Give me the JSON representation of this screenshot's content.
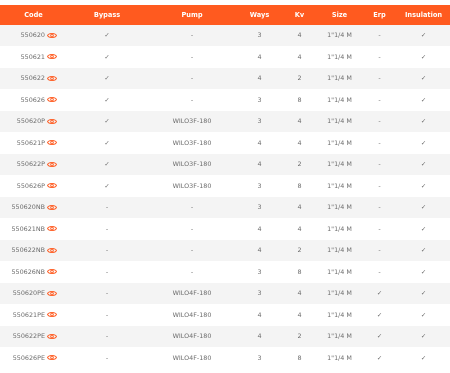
{
  "table": {
    "headers": [
      "Code",
      "Bypass",
      "Pump",
      "Ways",
      "Kv",
      "Size",
      "Erp",
      "Insulation"
    ],
    "rows": [
      {
        "code": "550620",
        "bypass": "✓",
        "pump": "-",
        "ways": "3",
        "kv": "4",
        "size": "1\"1/4 M",
        "erp": "-",
        "insulation": "✓"
      },
      {
        "code": "550621",
        "bypass": "✓",
        "pump": "-",
        "ways": "4",
        "kv": "4",
        "size": "1\"1/4 M",
        "erp": "-",
        "insulation": "✓"
      },
      {
        "code": "550622",
        "bypass": "✓",
        "pump": "-",
        "ways": "4",
        "kv": "2",
        "size": "1\"1/4 M",
        "erp": "-",
        "insulation": "✓"
      },
      {
        "code": "550626",
        "bypass": "✓",
        "pump": "-",
        "ways": "3",
        "kv": "8",
        "size": "1\"1/4 M",
        "erp": "-",
        "insulation": "✓"
      },
      {
        "code": "550620P",
        "bypass": "✓",
        "pump": "WILO3F-180",
        "ways": "3",
        "kv": "4",
        "size": "1\"1/4 M",
        "erp": "-",
        "insulation": "✓"
      },
      {
        "code": "550621P",
        "bypass": "✓",
        "pump": "WILO3F-180",
        "ways": "4",
        "kv": "4",
        "size": "1\"1/4 M",
        "erp": "-",
        "insulation": "✓"
      },
      {
        "code": "550622P",
        "bypass": "✓",
        "pump": "WILO3F-180",
        "ways": "4",
        "kv": "2",
        "size": "1\"1/4 M",
        "erp": "-",
        "insulation": "✓"
      },
      {
        "code": "550626P",
        "bypass": "✓",
        "pump": "WILO3F-180",
        "ways": "3",
        "kv": "8",
        "size": "1\"1/4 M",
        "erp": "-",
        "insulation": "✓"
      },
      {
        "code": "550620NB",
        "bypass": "-",
        "pump": "-",
        "ways": "3",
        "kv": "4",
        "size": "1\"1/4 M",
        "erp": "-",
        "insulation": "✓"
      },
      {
        "code": "550621NB",
        "bypass": "-",
        "pump": "-",
        "ways": "4",
        "kv": "4",
        "size": "1\"1/4 M",
        "erp": "-",
        "insulation": "✓"
      },
      {
        "code": "550622NB",
        "bypass": "-",
        "pump": "-",
        "ways": "4",
        "kv": "2",
        "size": "1\"1/4 M",
        "erp": "-",
        "insulation": "✓"
      },
      {
        "code": "550626NB",
        "bypass": "-",
        "pump": "-",
        "ways": "3",
        "kv": "8",
        "size": "1\"1/4 M",
        "erp": "-",
        "insulation": "✓"
      },
      {
        "code": "550620PE",
        "bypass": "-",
        "pump": "WILO4F-180",
        "ways": "3",
        "kv": "4",
        "size": "1\"1/4 M",
        "erp": "✓",
        "insulation": "✓"
      },
      {
        "code": "550621PE",
        "bypass": "-",
        "pump": "WILO4F-180",
        "ways": "4",
        "kv": "4",
        "size": "1\"1/4 M",
        "erp": "✓",
        "insulation": "✓"
      },
      {
        "code": "550622PE",
        "bypass": "-",
        "pump": "WILO4F-180",
        "ways": "4",
        "kv": "2",
        "size": "1\"1/4 M",
        "erp": "✓",
        "insulation": "✓"
      },
      {
        "code": "550626PE",
        "bypass": "-",
        "pump": "WILO4F-180",
        "ways": "3",
        "kv": "8",
        "size": "1\"1/4 M",
        "erp": "✓",
        "insulation": "✓"
      }
    ]
  },
  "icons": {
    "view": "eye-icon"
  },
  "colors": {
    "header_bg": "#ff5a1f",
    "header_text": "#ffffff",
    "accent": "#ff5a1f",
    "row_alt": "#f4f4f4",
    "text": "#6b6b6b"
  }
}
